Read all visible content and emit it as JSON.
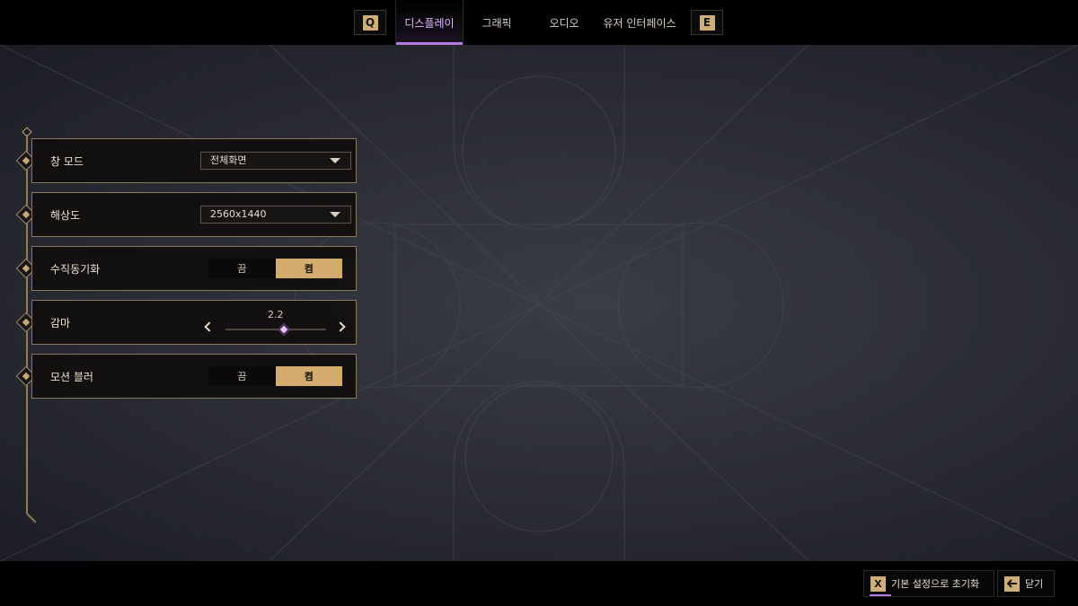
{
  "topbar": {
    "left_key": "Q",
    "right_key": "E",
    "tabs": [
      {
        "label": "디스플레이",
        "active": true
      },
      {
        "label": "그래픽",
        "active": false
      },
      {
        "label": "오디오",
        "active": false
      },
      {
        "label": "유저 인터페이스",
        "active": false
      }
    ]
  },
  "settings": [
    {
      "label": "창 모드",
      "type": "dropdown",
      "value": "전체화면"
    },
    {
      "label": "해상도",
      "type": "dropdown",
      "value": "2560x1440"
    },
    {
      "label": "수직동기화",
      "type": "toggle",
      "off_label": "끔",
      "on_label": "켬",
      "selected": "on"
    },
    {
      "label": "감마",
      "type": "slider",
      "value": "2.2",
      "level": 0.6
    },
    {
      "label": "모션 블러",
      "type": "toggle",
      "off_label": "끔",
      "on_label": "켬",
      "selected": "on"
    }
  ],
  "bottombar": {
    "reset_key": "X",
    "reset_label": "기본 설정으로 초기화",
    "close_key_icon": "arrow-left-icon",
    "close_label": "닫기"
  },
  "colors": {
    "accent_gold": "#d3ab6e",
    "accent_purple": "#b57be0",
    "panel_border": "#8c7a60"
  }
}
